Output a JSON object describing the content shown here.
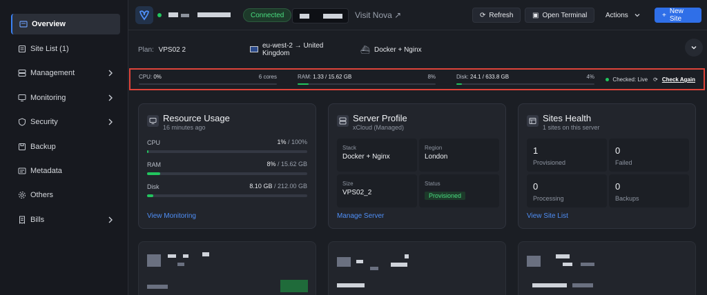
{
  "sidebar": {
    "items": [
      {
        "label": "Overview",
        "icon": "overview-icon",
        "active": true
      },
      {
        "label": "Site List (1)",
        "icon": "list-icon"
      },
      {
        "label": "Management",
        "icon": "server-icon",
        "chevron": true
      },
      {
        "label": "Monitoring",
        "icon": "monitor-icon",
        "chevron": true
      },
      {
        "label": "Security",
        "icon": "shield-icon",
        "chevron": true
      },
      {
        "label": "Backup",
        "icon": "backup-icon"
      },
      {
        "label": "Metadata",
        "icon": "metadata-icon"
      },
      {
        "label": "Others",
        "icon": "gear-icon"
      },
      {
        "label": "Bills",
        "icon": "bills-icon",
        "chevron": true
      }
    ]
  },
  "header": {
    "status": "Connected",
    "visit": "Visit Nova ↗",
    "refresh": "Refresh",
    "open_terminal": "Open Terminal",
    "actions": "Actions",
    "new_site": "New Site"
  },
  "info": {
    "plan_label": "Plan:",
    "plan_value": "VPS02 2",
    "region_line1": "eu-west-2 → United",
    "region_line2": "Kingdom",
    "stack": "Docker + Nginx"
  },
  "metrics": {
    "cpu_label": "CPU:",
    "cpu_value": "0%",
    "cpu_cores": "6 cores",
    "cpu_fill": 0,
    "ram_label": "RAM:",
    "ram_value": "1.33 / 15.62 GB",
    "ram_pct": "8%",
    "ram_fill": 8,
    "disk_label": "Disk:",
    "disk_value": "24.1 / 633.8 GB",
    "disk_pct": "4%",
    "disk_fill": 4,
    "checked": "Checked: Live",
    "check_again": "Check Again"
  },
  "resource": {
    "title": "Resource Usage",
    "sub": "16 minutes ago",
    "cpu_label": "CPU",
    "cpu_used": "1%",
    "cpu_total": " / 100%",
    "cpu_fill": 1,
    "ram_label": "RAM",
    "ram_used": "8%",
    "ram_total": " / 15.62 GB",
    "ram_fill": 8,
    "disk_label": "Disk",
    "disk_used": "8.10 GB",
    "disk_total": " / 212.00 GB",
    "disk_fill": 4,
    "link": "View Monitoring"
  },
  "profile": {
    "title": "Server Profile",
    "sub": "xCloud (Managed)",
    "stack_k": "Stack",
    "stack_v": "Docker + Nginx",
    "region_k": "Region",
    "region_v": "London",
    "size_k": "Size",
    "size_v": "VPS02_2",
    "status_k": "Status",
    "status_v": "Provisioned",
    "link": "Manage Server"
  },
  "health": {
    "title": "Sites Health",
    "sub": "1 sites on this server",
    "provisioned_n": "1",
    "provisioned_k": "Provisioned",
    "failed_n": "0",
    "failed_k": "Failed",
    "processing_n": "0",
    "processing_k": "Processing",
    "backups_n": "0",
    "backups_k": "Backups",
    "link": "View Site List"
  },
  "colors": {
    "accent": "#2f6fe8",
    "success": "#22c55e",
    "link": "#4f8ff7",
    "highlight_border": "#e0443a"
  }
}
